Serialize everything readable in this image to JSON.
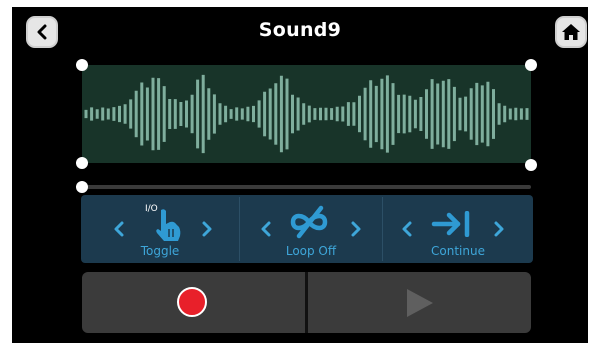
{
  "header": {
    "title": "Sound9",
    "back_icon": "chevron-left-icon",
    "home_icon": "home-icon"
  },
  "waveform": {
    "color": "#7fae9d",
    "background": "#183429",
    "selection_start": 0.0,
    "selection_end": 1.0
  },
  "scrubber": {
    "position": 0.0
  },
  "modes": [
    {
      "label": "Toggle",
      "icon": "touch-toggle-icon",
      "icon_text": "I/O"
    },
    {
      "label": "Loop Off",
      "icon": "loop-off-icon"
    },
    {
      "label": "Continue",
      "icon": "continue-icon"
    }
  ],
  "transport": {
    "record_icon": "record-icon",
    "play_icon": "play-icon",
    "record_color": "#e8202a"
  },
  "colors": {
    "accent": "#3ea6d9",
    "panel": "#1c3a4e",
    "transport": "#3b3b3b"
  }
}
